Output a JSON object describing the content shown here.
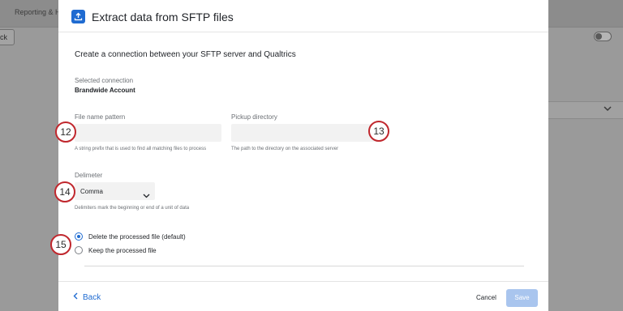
{
  "background": {
    "tab_label": "Reporting & Hi",
    "back_label": "ck"
  },
  "modal": {
    "title": "Extract data from SFTP files",
    "lead": "Create a connection between your SFTP server and Qualtrics",
    "selected_connection": {
      "label": "Selected connection",
      "value": "Brandwide Account"
    },
    "file_name_pattern": {
      "label": "File name pattern",
      "value": "",
      "help": "A string prefix that is used to find all matching files to process"
    },
    "pickup_directory": {
      "label": "Pickup directory",
      "value": "",
      "help": "The path to the directory on the associated server"
    },
    "delimeter": {
      "label": "Delimeter",
      "selected": "Comma",
      "help": "Delimiters mark the beginning or end of a unit of data"
    },
    "radios": [
      {
        "label": "Delete the processed file (default)",
        "checked": true
      },
      {
        "label": "Keep the processed file",
        "checked": false
      }
    ],
    "footer": {
      "back_label": "Back",
      "cancel_label": "Cancel",
      "save_label": "Save"
    }
  },
  "markers": [
    "12",
    "13",
    "14",
    "15"
  ],
  "colors": {
    "accent": "#1f6bd1",
    "marker_border": "#c0272d",
    "save_disabled": "#a9c5ee"
  }
}
